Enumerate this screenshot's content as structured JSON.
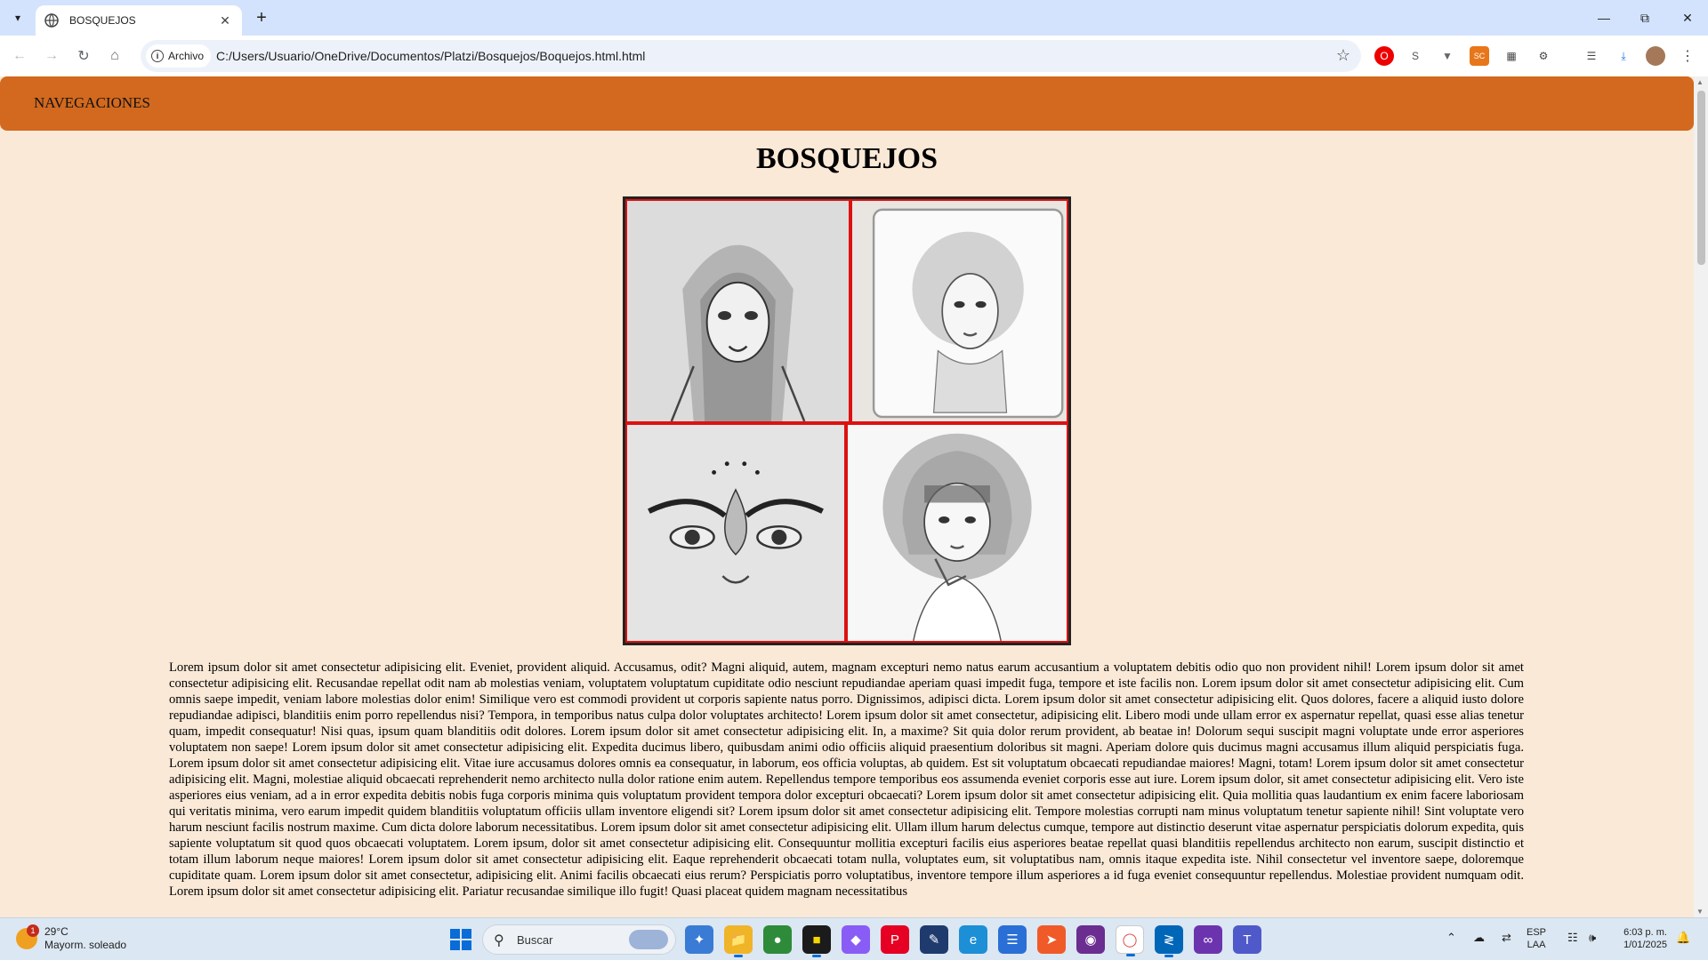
{
  "browser": {
    "tab_title": "BOSQUEJOS",
    "new_tab": "+",
    "site_chip": "Archivo",
    "url": "C:/Users/Usuario/OneDrive/Documentos/Platzi/Bosquejos/Boquejos.html.html",
    "ext_sc": "SC"
  },
  "page": {
    "nav_label": "NAVEGACIONES",
    "heading": "BOSQUEJOS",
    "gallery": [
      "sketch-girl-hood",
      "sketch-girl-curly-hair",
      "sketch-eyes-flower",
      "sketch-girl-bob"
    ],
    "lorem": "Lorem ipsum dolor sit amet consectetur adipisicing elit. Eveniet, provident aliquid. Accusamus, odit? Magni aliquid, autem, magnam excepturi nemo natus earum accusantium a voluptatem debitis odio quo non provident nihil! Lorem ipsum dolor sit amet consectetur adipisicing elit. Recusandae repellat odit nam ab molestias veniam, voluptatem voluptatum cupiditate odio nesciunt repudiandae aperiam quasi impedit fuga, tempore et iste facilis non. Lorem ipsum dolor sit amet consectetur adipisicing elit. Cum omnis saepe impedit, veniam labore molestias dolor enim! Similique vero est commodi provident ut corporis sapiente natus porro. Dignissimos, adipisci dicta. Lorem ipsum dolor sit amet consectetur adipisicing elit. Quos dolores, facere a aliquid iusto dolore repudiandae adipisci, blanditiis enim porro repellendus nisi? Tempora, in temporibus natus culpa dolor voluptates architecto! Lorem ipsum dolor sit amet consectetur, adipisicing elit. Libero modi unde ullam error ex aspernatur repellat, quasi esse alias tenetur quam, impedit consequatur! Nisi quas, ipsum quam blanditiis odit dolores. Lorem ipsum dolor sit amet consectetur adipisicing elit. In, a maxime? Sit quia dolor rerum provident, ab beatae in! Dolorum sequi suscipit magni voluptate unde error asperiores voluptatem non saepe! Lorem ipsum dolor sit amet consectetur adipisicing elit. Expedita ducimus libero, quibusdam animi odio officiis aliquid praesentium doloribus sit magni. Aperiam dolore quis ducimus magni accusamus illum aliquid perspiciatis fuga. Lorem ipsum dolor sit amet consectetur adipisicing elit. Vitae iure accusamus dolores omnis ea consequatur, in laborum, eos officia voluptas, ab quidem. Est sit voluptatum obcaecati repudiandae maiores! Magni, totam! Lorem ipsum dolor sit amet consectetur adipisicing elit. Magni, molestiae aliquid obcaecati reprehenderit nemo architecto nulla dolor ratione enim autem. Repellendus tempore temporibus eos assumenda eveniet corporis esse aut iure. Lorem ipsum dolor, sit amet consectetur adipisicing elit. Vero iste asperiores eius veniam, ad a in error expedita debitis nobis fuga corporis minima quis voluptatum provident tempora dolor excepturi obcaecati? Lorem ipsum dolor sit amet consectetur adipisicing elit. Quia mollitia quas laudantium ex enim facere laboriosam qui veritatis minima, vero earum impedit quidem blanditiis voluptatum officiis ullam inventore eligendi sit? Lorem ipsum dolor sit amet consectetur adipisicing elit. Tempore molestias corrupti nam minus voluptatum tenetur sapiente nihil! Sint voluptate vero harum nesciunt facilis nostrum maxime. Cum dicta dolore laborum necessitatibus. Lorem ipsum dolor sit amet consectetur adipisicing elit. Ullam illum harum delectus cumque, tempore aut distinctio deserunt vitae aspernatur perspiciatis dolorum expedita, quis sapiente voluptatum sit quod quos obcaecati voluptatem. Lorem ipsum, dolor sit amet consectetur adipisicing elit. Consequuntur mollitia excepturi facilis eius asperiores beatae repellat quasi blanditiis repellendus architecto non earum, suscipit distinctio et totam illum laborum neque maiores! Lorem ipsum dolor sit amet consectetur adipisicing elit. Eaque reprehenderit obcaecati totam nulla, voluptates eum, sit voluptatibus nam, omnis itaque expedita iste. Nihil consectetur vel inventore saepe, doloremque cupiditate quam. Lorem ipsum dolor sit amet consectetur, adipisicing elit. Animi facilis obcaecati eius rerum? Perspiciatis porro voluptatibus, inventore tempore illum asperiores a id fuga eveniet consequuntur repellendus. Molestiae provident numquam odit. Lorem ipsum dolor sit amet consectetur adipisicing elit. Pariatur recusandae similique illo fugit! Quasi placeat quidem magnam necessitatibus"
  },
  "taskbar": {
    "weather_badge": "1",
    "weather_temp": "29°C",
    "weather_desc": "Mayorm. soleado",
    "search_label": "Buscar",
    "lang_1": "ESP",
    "lang_2": "LAA",
    "time": "6:03 p. m.",
    "date": "1/01/2025"
  },
  "colors": {
    "nav_bg": "#d2691e",
    "page_bg": "#fae9d7",
    "gallery_cell_border": "#dd1111"
  }
}
